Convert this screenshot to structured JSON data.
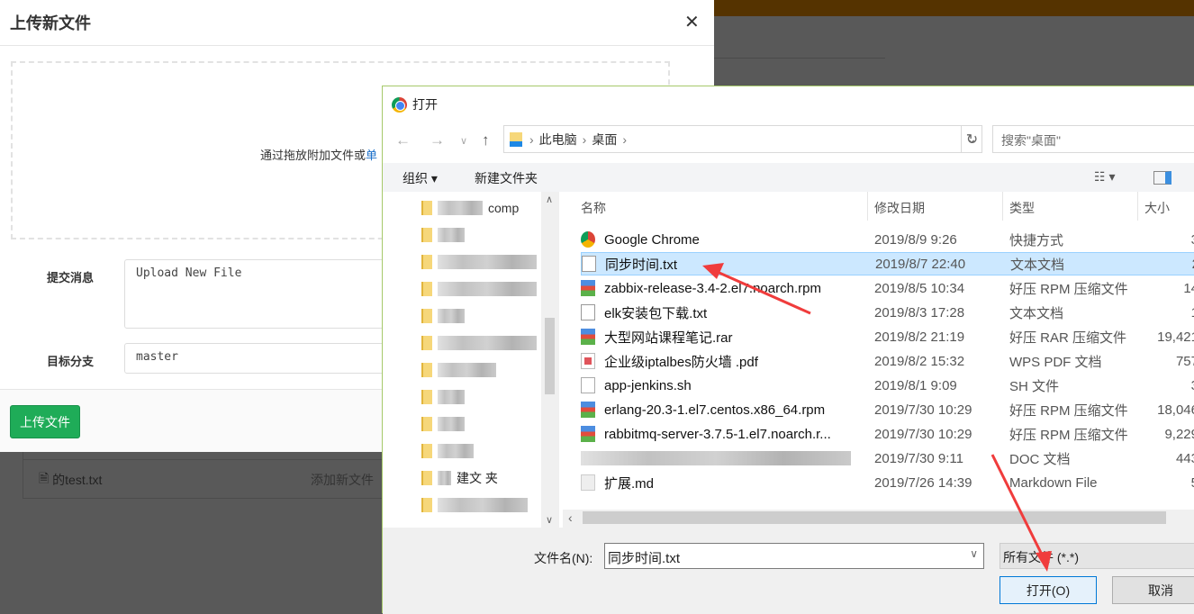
{
  "background": {
    "file_row": {
      "name": "的test.txt",
      "action": "添加新文件"
    }
  },
  "upload_modal": {
    "title": "上传新文件",
    "drop_text": "通过拖放附加文件或",
    "drop_link": "单",
    "commit_label": "提交消息",
    "commit_value": "Upload New File",
    "branch_label": "目标分支",
    "branch_value": "master",
    "submit": "上传文件",
    "accent": "#1fac58"
  },
  "open_dialog": {
    "title": "打开",
    "breadcrumb": [
      "此电脑",
      "桌面"
    ],
    "search_placeholder": "搜索\"桌面\"",
    "toolbar": {
      "organize": "组织 ▾",
      "new_folder": "新建文件夹"
    },
    "tree_fragments": [
      "comp",
      "建文 夹"
    ],
    "columns": [
      "名称",
      "修改日期",
      "类型",
      "大小"
    ],
    "files": [
      {
        "name": "Google Chrome",
        "date": "2019/8/9 9:26",
        "type": "快捷方式",
        "size": "3",
        "icon": "chrome"
      },
      {
        "name": "同步时间.txt",
        "date": "2019/8/7 22:40",
        "type": "文本文档",
        "size": "2",
        "icon": "txt",
        "selected": true
      },
      {
        "name": "zabbix-release-3.4-2.el7.noarch.rpm",
        "date": "2019/8/5 10:34",
        "type": "好压 RPM 压缩文件",
        "size": "14",
        "icon": "rar"
      },
      {
        "name": "elk安装包下载.txt",
        "date": "2019/8/3 17:28",
        "type": "文本文档",
        "size": "1",
        "icon": "txt"
      },
      {
        "name": "大型网站课程笔记.rar",
        "date": "2019/8/2 21:19",
        "type": "好压 RAR 压缩文件",
        "size": "19,421",
        "icon": "rar"
      },
      {
        "name": "企业级iptalbes防火墙 .pdf",
        "date": "2019/8/2 15:32",
        "type": "WPS PDF 文档",
        "size": "757",
        "icon": "pdf"
      },
      {
        "name": "app-jenkins.sh",
        "date": "2019/8/1 9:09",
        "type": "SH 文件",
        "size": "3",
        "icon": "sh"
      },
      {
        "name": "erlang-20.3-1.el7.centos.x86_64.rpm",
        "date": "2019/7/30 10:29",
        "type": "好压 RPM 压缩文件",
        "size": "18,046",
        "icon": "rar"
      },
      {
        "name": "rabbitmq-server-3.7.5-1.el7.noarch.r...",
        "date": "2019/7/30 10:29",
        "type": "好压 RPM 压缩文件",
        "size": "9,229",
        "icon": "rar"
      },
      {
        "name": "",
        "date": "2019/7/30 9:11",
        "type": "DOC 文档",
        "size": "443",
        "icon": "blurred"
      },
      {
        "name": "扩展.md",
        "date": "2019/7/26 14:39",
        "type": "Markdown File",
        "size": "5",
        "icon": "md"
      }
    ],
    "filename_label": "文件名(N):",
    "filename_value": "同步时间.txt",
    "filter": "所有文件 (*.*)",
    "open_button": "打开(O)",
    "cancel_button": "取消"
  }
}
